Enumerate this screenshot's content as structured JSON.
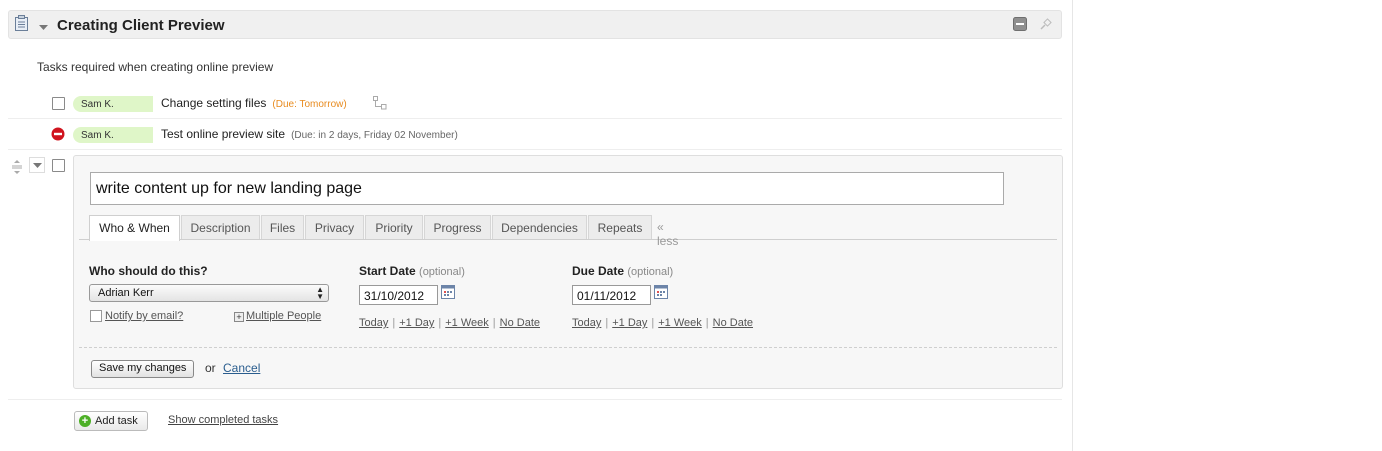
{
  "tasklist": {
    "title": "Creating Client Preview",
    "description": "Tasks required when creating online preview",
    "icons": {
      "list": "clipboard-icon",
      "toggle": "triangle-down-icon",
      "minimize": "minimize-icon",
      "pin": "pin-icon"
    }
  },
  "tasks": [
    {
      "assignee": "Sam K.",
      "name": "Change setting files",
      "due": "(Due: Tomorrow)",
      "due_color": "#e88b1f",
      "status": "open",
      "extra_icon": "subtask-icon"
    },
    {
      "assignee": "Sam K.",
      "name": "Test online preview site",
      "due": "(Due: in 2 days, Friday 02 November)",
      "due_color": "#666666",
      "status": "blocked"
    }
  ],
  "editor": {
    "task_text": "write content up for new landing page",
    "tabs": [
      "Who & When",
      "Description",
      "Files",
      "Privacy",
      "Priority",
      "Progress",
      "Dependencies",
      "Repeats"
    ],
    "active_tab": "Who & When",
    "less_label": "« less",
    "who": {
      "label": "Who should do this?",
      "selected": "Adrian Kerr",
      "notify_label": "Notify by email?",
      "multiple_label": "Multiple People"
    },
    "start": {
      "label": "Start Date",
      "optional": "(optional)",
      "value": "31/10/2012",
      "quick": [
        "Today",
        "+1 Day",
        "+1 Week",
        "No Date"
      ]
    },
    "due": {
      "label": "Due Date",
      "optional": "(optional)",
      "value": "01/11/2012",
      "quick": [
        "Today",
        "+1 Day",
        "+1 Week",
        "No Date"
      ]
    },
    "save_label": "Save my changes",
    "or_label": "or",
    "cancel_label": "Cancel"
  },
  "footer": {
    "add_task_label": "Add task",
    "show_completed_label": "Show completed tasks"
  },
  "colors": {
    "assignee_bg": "#dff6c8",
    "due_soon": "#e88b1f",
    "link": "#2a5d8e",
    "blocked": "#d0141e",
    "add_green": "#4caf26"
  }
}
